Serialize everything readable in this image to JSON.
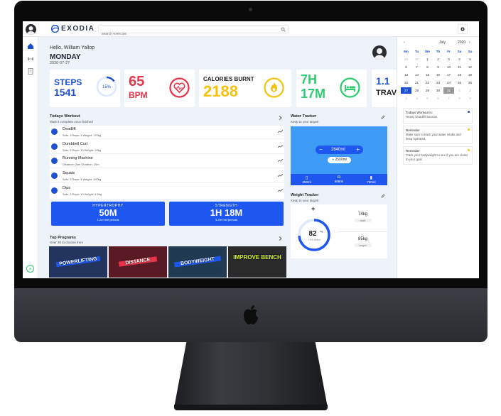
{
  "app": {
    "name": "EXODIA",
    "search_placeholder": "search exercise"
  },
  "header": {
    "greeting": "Hello, William Yallop",
    "day": "MONDAY",
    "date": "2020-07-27"
  },
  "stats": [
    {
      "label": "STEPS",
      "value": "1541",
      "ring_text": "15%",
      "percent": 15,
      "color": "#1d4fd1"
    },
    {
      "label": "65",
      "unit": "BPM",
      "color": "#e8334a"
    },
    {
      "label": "CALORIES BURNT",
      "value": "2188",
      "color": "#f4c20d"
    },
    {
      "hours": "7H",
      "minutes": "17M",
      "color": "#2ecc71"
    },
    {
      "label": "TRAVE",
      "value": "1.1"
    }
  ],
  "workout": {
    "title": "Todays Workout",
    "subtitle": "Mark it complete once finished",
    "items": [
      {
        "name": "Deadlift",
        "meta": "Sets: 3   Reps: 4   Weight: 170kg"
      },
      {
        "name": "Dumbbell Curl",
        "meta": "Sets: 3   Reps: 10   Weight: 20kg"
      },
      {
        "name": "Running Machine",
        "meta": "Distance: 2km   Duration: 20m"
      },
      {
        "name": "Squats",
        "meta": "Sets: 3   Reps: 4   Weight: 100kg"
      },
      {
        "name": "Dips",
        "meta": "Sets: 3   Reps: 10   Weight: 8.5kg"
      }
    ],
    "promos": [
      {
        "title": "HYPERTROPHY",
        "value": "50M",
        "note": "1-2m rest periods"
      },
      {
        "title": "STRENGTH",
        "value": "1H 18M",
        "note": "3-4m rest periods"
      }
    ]
  },
  "programs": {
    "title": "Top Programs",
    "subtitle": "Over 30 to choose from",
    "items": [
      {
        "label": "POWERLIFTING",
        "bg": "#23355f"
      },
      {
        "label": "DISTANCE",
        "bg": "#5a1a24"
      },
      {
        "label": "BODYWEIGHT",
        "bg": "#203a52"
      },
      {
        "label": "IMPROVE BENCH",
        "bg": "#2b2b2b"
      }
    ]
  },
  "water": {
    "title": "Water Tracker",
    "subtitle": "Keep to your target!",
    "amount": "2840ml",
    "target": "2500ml",
    "cups": [
      "250ml",
      "568ml",
      "750ml"
    ]
  },
  "weight": {
    "title": "Weight Tracker",
    "subtitle": "Keep to your target!",
    "current": "82",
    "unit": "kg",
    "ring_label": "74% there",
    "percent": 74,
    "start_value": "74kg",
    "start_label": "start",
    "target_value": "85kg",
    "target_label": "target"
  },
  "calendar": {
    "month": "July",
    "year": "2020",
    "dow": [
      "Mo",
      "Tu",
      "We",
      "Th",
      "Fr",
      "Sa",
      "Su"
    ],
    "days": [
      [
        "29",
        "30",
        "1",
        "2",
        "3",
        "4",
        "5"
      ],
      [
        "6",
        "7",
        "8",
        "9",
        "10",
        "11",
        "12"
      ],
      [
        "13",
        "14",
        "15",
        "16",
        "17",
        "18",
        "19"
      ],
      [
        "20",
        "21",
        "22",
        "23",
        "24",
        "25",
        "26"
      ],
      [
        "27",
        "28",
        "29",
        "30",
        "31",
        "1",
        "2"
      ],
      [
        "3",
        "4",
        "5",
        "6",
        "7",
        "8",
        "9"
      ]
    ]
  },
  "notes": [
    {
      "title": "Todays Workout is:",
      "body": "Heavy Deadlift Session",
      "color": "#1d4fd1"
    },
    {
      "title": "Reminder",
      "body": "Make sure to track your water intake and keep hydrated.",
      "color": "#f4c20d"
    },
    {
      "title": "Reminder",
      "body": "Track your bodyweight to see if you are closer to your goal.",
      "color": "#f4c20d"
    }
  ]
}
